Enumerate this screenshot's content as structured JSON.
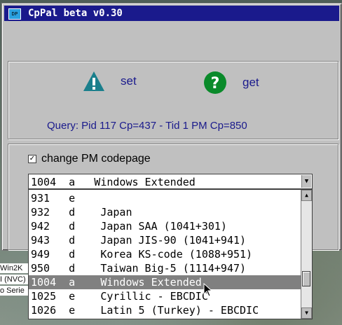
{
  "window": {
    "title": "CpPal beta v0.30",
    "app_icon_text": "DP"
  },
  "actions": {
    "set_label": "set",
    "get_label": "get",
    "set_icon": "warning-triangle-icon",
    "get_icon": "question-circle-icon"
  },
  "query_text": "Query:  Pid 117  Cp=437 - Tid 1  PM Cp=850",
  "change_codepage": {
    "label": "change PM codepage",
    "checked": true
  },
  "codepage_combo": {
    "selected": "1004  a   Windows Extended"
  },
  "codepage_list": {
    "items": [
      "931   e",
      "932   d    Japan",
      "942   d    Japan SAA (1041+301)",
      "943   d    Japan JIS-90 (1041+941)",
      "949   d    Korea KS-code (1088+951)",
      "950   d    Taiwan Big-5 (1114+947)",
      "1004  a    Windows Extended",
      "1025  e    Cyrillic - EBCDIC",
      "1026  e    Latin 5 (Turkey) - EBCDIC"
    ],
    "selected_index": 6
  },
  "background": {
    "snippets": [
      "Win2K",
      "I (NVC)",
      "o Serie"
    ]
  },
  "colors": {
    "title_bar": "#1a1a8c",
    "label_blue": "#1a1a8c",
    "window_face": "#c0c0c0",
    "selection": "#808080",
    "warning_teal": "#1a7f8c",
    "help_green": "#0a8a2a"
  }
}
